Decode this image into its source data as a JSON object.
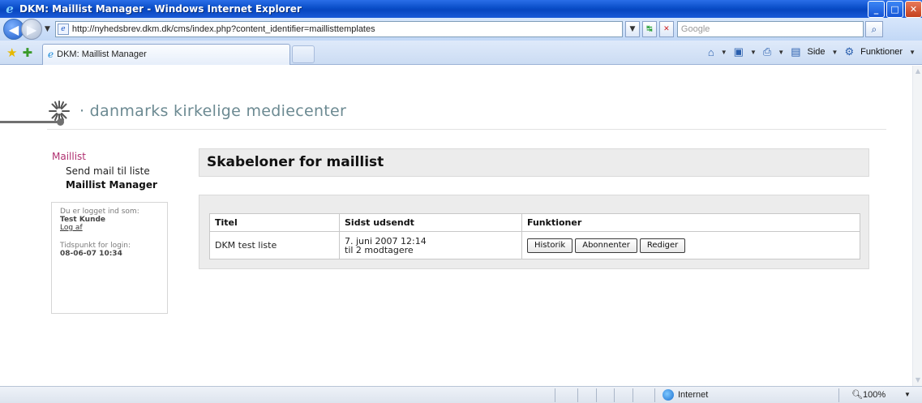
{
  "window": {
    "title": "DKM: Maillist Manager - Windows Internet Explorer"
  },
  "address_bar": {
    "url": "http://nyhedsbrev.dkm.dk/cms/index.php?content_identifier=maillisttemplates",
    "search_placeholder": "Google"
  },
  "tab": {
    "label": "DKM: Maillist Manager"
  },
  "command_bar": {
    "side_label": "Side",
    "funktioner_label": "Funktioner"
  },
  "site": {
    "brand": "· danmarks  kirkelige  mediecenter"
  },
  "sidebar": {
    "root": "Maillist",
    "items": [
      {
        "label": "Send mail til liste"
      },
      {
        "label": "Maillist Manager"
      }
    ]
  },
  "login": {
    "logged_in_label": "Du er logget ind som:",
    "user": "Test Kunde",
    "logout": "Log af",
    "time_label": "Tidspunkt for login:",
    "time": "08-06-07 10:34"
  },
  "main": {
    "heading": "Skabeloner for maillist",
    "table": {
      "headers": [
        "Titel",
        "Sidst udsendt",
        "Funktioner"
      ],
      "rows": [
        {
          "title": "DKM test liste",
          "sent_line1": "7. juni 2007 12:14",
          "sent_line2": "til 2 modtagere",
          "buttons": [
            "Historik",
            "Abonnenter",
            "Rediger"
          ]
        }
      ]
    }
  },
  "status_bar": {
    "zone": "Internet",
    "zoom": "100%"
  }
}
